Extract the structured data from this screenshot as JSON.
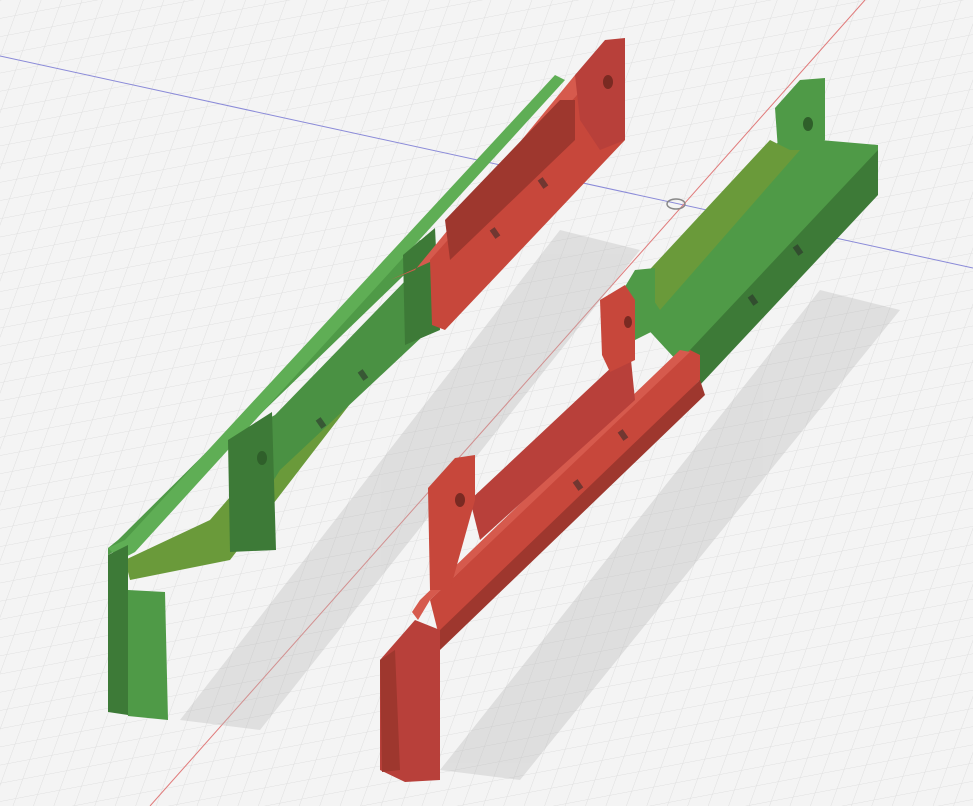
{
  "viewport": {
    "background": "#f4f4f4",
    "grid_minor_color": "#dcdcdc",
    "grid_major_color": "#c9c9c9",
    "x_axis_color": "#e07a7a",
    "z_axis_color": "#8a8ad8"
  },
  "parts": {
    "green_color": "#4f9a47",
    "green_dark": "#3d7a37",
    "green_light": "#5fae55",
    "red_color": "#c7473b",
    "red_dark": "#9e372e",
    "red_light": "#d65a4d",
    "shadow_color": "#cfcfcf"
  },
  "origin_marker": {
    "icon": "origin-circle-icon"
  }
}
